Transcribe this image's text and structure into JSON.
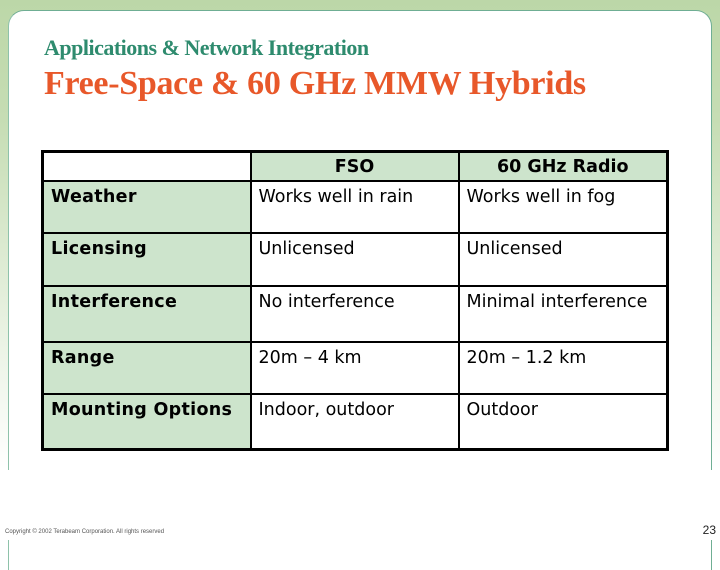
{
  "slide": {
    "subtitle": "Applications & Network Integration",
    "title": "Free-Space & 60 GHz MMW Hybrids",
    "colors": {
      "subtitle": "#2e8b6e",
      "title": "#e8582a",
      "label_cell": "#cde4cc",
      "frame": "#bcd7a8"
    }
  },
  "table": {
    "headers": [
      "",
      "FSO",
      "60 GHz Radio"
    ],
    "rows": [
      {
        "label": "Weather",
        "fso": "Works well in rain",
        "radio": "Works well in fog"
      },
      {
        "label": "Licensing",
        "fso": "Unlicensed",
        "radio": "Unlicensed"
      },
      {
        "label": "Interference",
        "fso": "No interference",
        "radio": "Minimal interference"
      },
      {
        "label": "Range",
        "fso": "20m – 4 km",
        "radio": "20m – 1.2 km"
      },
      {
        "label": "Mounting Options",
        "fso": "Indoor, outdoor",
        "radio": "Outdoor"
      }
    ]
  },
  "footer": {
    "copyright": "Copyright © 2002 Terabeam Corporation. All rights reserved",
    "page_number": "23"
  }
}
